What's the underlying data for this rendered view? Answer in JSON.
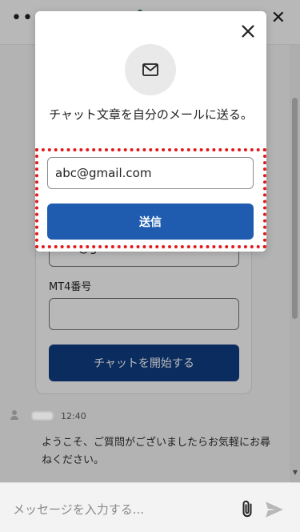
{
  "colors": {
    "primary_button": "#1f5cb0",
    "start_button": "#0f3d84",
    "highlight": "#e2191a",
    "composer_bg": "#f3f3f3"
  },
  "topbar": {
    "menu_icon": "more-dots-icon",
    "close_icon": "close-icon"
  },
  "background_form": {
    "email_value": "abc@gmail.com",
    "mt4_label": "MT4番号",
    "mt4_value": "",
    "start_button": "チャットを開始する"
  },
  "message": {
    "time": "12:40",
    "text": "ようこそ、ご質問がございましたらお気軽にお尋ねください。"
  },
  "composer": {
    "placeholder": "メッセージを入力する...",
    "attach_icon": "paperclip-icon",
    "send_icon": "send-icon"
  },
  "modal": {
    "icon": "mail-icon",
    "close_icon": "close-icon",
    "text": "チャット文章を自分のメールに送る。",
    "email_value": "abc@gmail.com",
    "send_label": "送信"
  }
}
